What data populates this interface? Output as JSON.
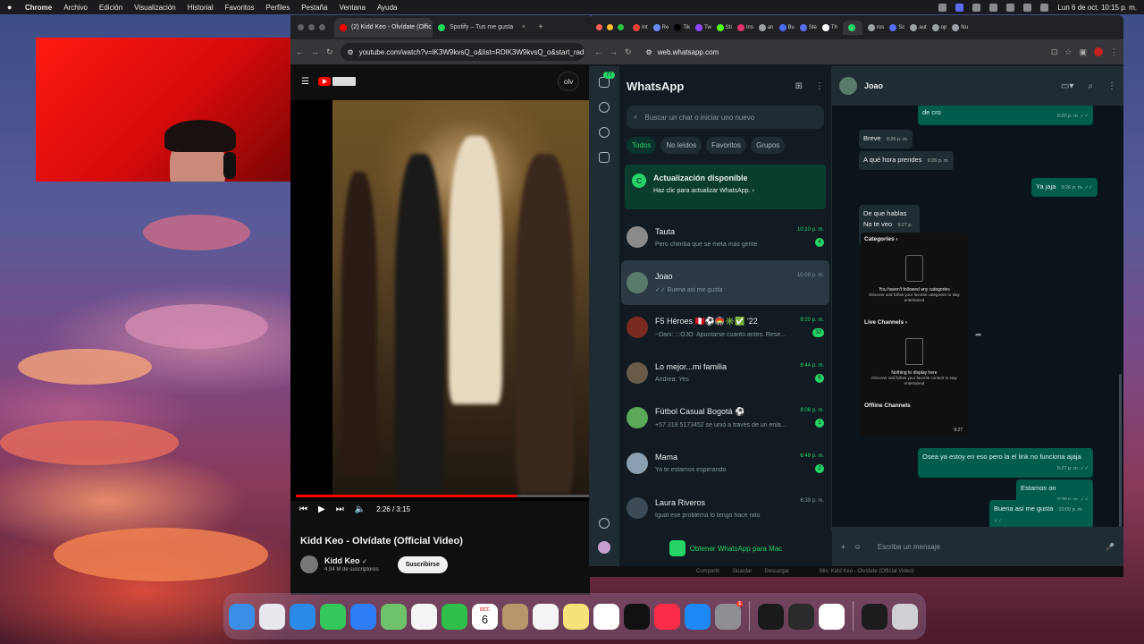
{
  "menubar": {
    "app": "Chrome",
    "items": [
      "Archivo",
      "Edición",
      "Visualización",
      "Historial",
      "Favoritos",
      "Perfiles",
      "Pestaña",
      "Ventana",
      "Ayuda"
    ],
    "datetime": "Lun 6 de oct. 10:15 p. m."
  },
  "youtube_window": {
    "tabs": [
      {
        "label": "(2) Kidd Keo - Olvídate (Offic",
        "icon": "youtube-icon",
        "color": "#ff0000"
      },
      {
        "label": "Spotify – Tus me gusta",
        "icon": "spotify-icon",
        "color": "#1ed760"
      }
    ],
    "url": "youtube.com/watch?v=lK3W9kvsQ_o&list=RDlK3W9kvsQ_o&start_radio=1",
    "search_partial": "olv",
    "player": {
      "time": "2:26 / 3:15",
      "progress": 0.75
    },
    "video_title": "Kidd Keo - Olvídate (Official Video)",
    "channel_name": "Kidd Keo",
    "subscribers": "4.94 M de suscriptores",
    "subscribe_label": "Suscribirse"
  },
  "whatsapp_window": {
    "tabs": [
      {
        "label": "Int",
        "icon": "gmail-icon",
        "color": "#ea4335"
      },
      {
        "label": "Re",
        "icon": "app-icon",
        "color": "#6a8cff"
      },
      {
        "label": "Tik",
        "icon": "tiktok-icon",
        "color": "#000000"
      },
      {
        "label": "Tw",
        "icon": "twitch-icon",
        "color": "#9146ff"
      },
      {
        "label": "Sti",
        "icon": "kick-icon",
        "color": "#53fc18"
      },
      {
        "label": "Ins",
        "icon": "instagram-icon",
        "color": "#e1306c"
      },
      {
        "label": "an",
        "icon": "chrome-icon",
        "color": "#9aa0a6"
      },
      {
        "label": "Bu",
        "icon": "app-icon",
        "color": "#4a6cf7"
      },
      {
        "label": "Ste",
        "icon": "app-icon",
        "color": "#5a6cf0"
      },
      {
        "label": "Th",
        "icon": "threads-icon",
        "color": "#ffffff"
      },
      {
        "label": "",
        "icon": "whatsapp-icon",
        "color": "#25d366"
      },
      {
        "label": "ros",
        "icon": "chrome-icon",
        "color": "#9aa0a6"
      },
      {
        "label": "Sc",
        "icon": "app-icon",
        "color": "#5a6cf0"
      },
      {
        "label": "aut",
        "icon": "chrome-icon",
        "color": "#9aa0a6"
      },
      {
        "label": "op",
        "icon": "chrome-icon",
        "color": "#9aa0a6"
      },
      {
        "label": "Nu",
        "icon": "app-icon",
        "color": "#9aa0a6"
      }
    ],
    "url": "web.whatsapp.com",
    "app_title": "WhatsApp",
    "rail_badge": "77",
    "search_placeholder": "Buscar un chat o iniciar uno nuevo",
    "filters": [
      "Todos",
      "No leídos",
      "Favoritos",
      "Grupos"
    ],
    "update_banner": {
      "title": "Actualización disponible",
      "subtitle": "Haz clic para actualizar WhatsApp. ›"
    },
    "chats": [
      {
        "name": "Tauta",
        "preview": "Pero chimba que se meta más gente",
        "time": "10:10 p. m.",
        "count": "4",
        "time_green": true,
        "avatar_color": "#8a8a8a"
      },
      {
        "name": "Joao",
        "preview": "✓✓ Buena asi me gusta",
        "time": "10:09 p. m.",
        "count": "",
        "time_green": false,
        "avatar_color": "#5a7a6a"
      },
      {
        "name": "F5 Héroes 🇵🇪⚽🏟️✳️✅ '22",
        "preview": "~Dani: :::OJO: Apuntarse cuanto antes. Rese...",
        "time": "9:20 p. m.",
        "count": "32",
        "time_green": true,
        "avatar_color": "#7a2a20"
      },
      {
        "name": "Lo mejor...mi familia",
        "preview": "Andrea: Yes",
        "time": "8:44 p. m.",
        "count": "6",
        "time_green": true,
        "avatar_color": "#6a5a4a"
      },
      {
        "name": "Fútbol Casual Bogotá ⚽",
        "preview": "+57 319 5173452 se unió a través de un enla...",
        "time": "8:06 p. m.",
        "count": "1",
        "time_green": true,
        "avatar_color": "#5aa85a"
      },
      {
        "name": "Mama",
        "preview": "Ya te estamos esperando",
        "time": "6:46 p. m.",
        "count": "2",
        "time_green": true,
        "avatar_color": "#8aa0b0"
      },
      {
        "name": "Laura Riveros",
        "preview": "Igual ese problema lo tengo hace rato",
        "time": "6:39 p. m.",
        "count": "",
        "time_green": false,
        "avatar_color": "#3b4a54"
      }
    ],
    "get_wa_label": "Obtener WhatsApp para Mac",
    "conversation": {
      "contact": "Joao",
      "messages": [
        {
          "dir": "out",
          "text": "de cro",
          "time": "9:20 p. m. ✓✓"
        },
        {
          "dir": "in",
          "text": "Breve",
          "time": "9:26 p. m."
        },
        {
          "dir": "in",
          "text": "A qué hora prendes",
          "time": "9:26 p. m."
        },
        {
          "dir": "out",
          "text": "Ya jaja",
          "time": "9:26 p. m. ✓✓"
        },
        {
          "dir": "in",
          "text": "De que hablas",
          "time": ""
        },
        {
          "dir": "in",
          "text": "No te veo",
          "time": "9:27 p. m."
        },
        {
          "dir": "out",
          "text": "Osea ya estoy en eso pero la el link no funciona ajaja",
          "time": "9:27 p. m. ✓✓"
        },
        {
          "dir": "out",
          "text": "Estamos on",
          "time": "9:38 p. m. ✓✓"
        },
        {
          "dir": "out",
          "text": "Buena asi me gusta",
          "time": "10:09 p. m. ✓✓"
        }
      ],
      "media": {
        "section1": "Categories ›",
        "empty1": "You haven't followed any categories",
        "empty1_sub": "Discover and follow your favorite categories to stay entertained",
        "section2": "Live Channels ›",
        "empty2": "Nothing to display here",
        "empty2_sub": "Discover and follow your favorite content to stay entertained",
        "section3": "Offline Channels",
        "time": "9:27"
      },
      "composer_placeholder": "Escribe un mensaje"
    }
  },
  "behind_strip": [
    "Compartir",
    "Guardar",
    "Descargar",
    "Mix: Kidd Keo - Olvídate (Official Video)"
  ],
  "dock": {
    "calendar_month": "OCT.",
    "calendar_day": "6",
    "appstore_badge": "1",
    "apps": [
      "finder-icon",
      "launchpad-icon",
      "safari-icon",
      "messages-icon",
      "mail-icon",
      "maps-icon",
      "photos-icon",
      "facetime-icon",
      "calendar-icon",
      "contacts-icon",
      "reminders-icon",
      "notes-icon",
      "freeform-icon",
      "appletv-icon",
      "music-icon",
      "appstore-icon",
      "settings-icon",
      "piano-icon",
      "obs-icon",
      "chrome-icon",
      "display-icon",
      "trash-icon"
    ]
  }
}
